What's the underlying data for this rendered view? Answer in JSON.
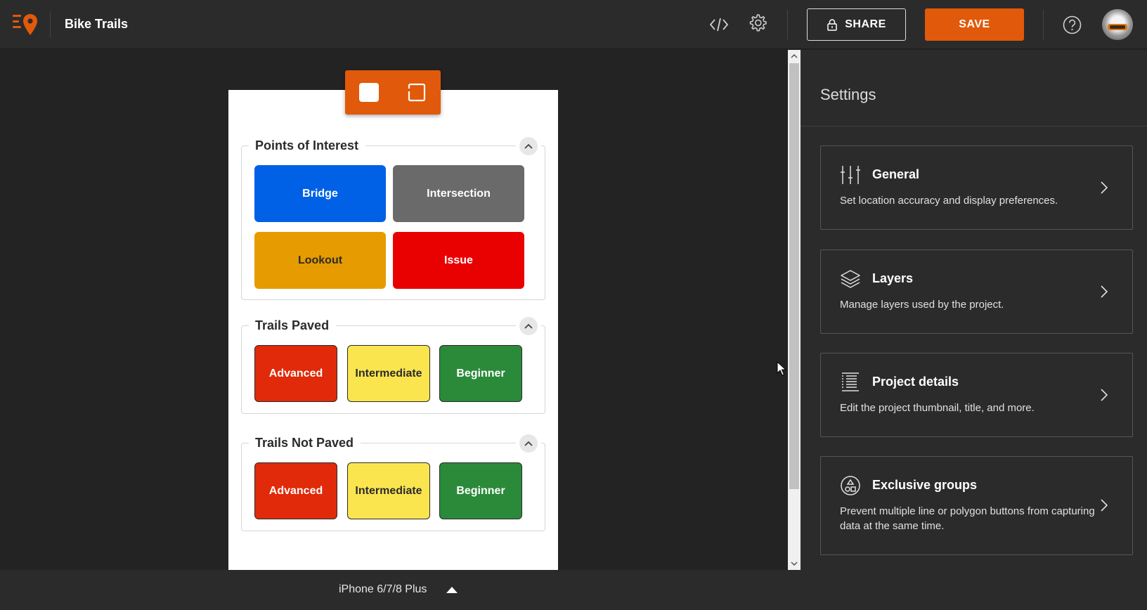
{
  "header": {
    "app_title": "Bike Trails",
    "share_label": "SHARE",
    "save_label": "SAVE"
  },
  "phone": {
    "groups": [
      {
        "title": "Points of Interest",
        "buttons": [
          {
            "label": "Bridge",
            "color": "#0061e6",
            "text_color": "#ffffff"
          },
          {
            "label": "Intersection",
            "color": "#6a6a6a",
            "text_color": "#ffffff"
          },
          {
            "label": "Lookout",
            "color": "#e69b00",
            "text_color": "#2b2b2b"
          },
          {
            "label": "Issue",
            "color": "#e90000",
            "text_color": "#ffffff"
          }
        ]
      },
      {
        "title": "Trails Paved",
        "buttons": [
          {
            "label": "Advanced",
            "color": "#e02a09",
            "text_color": "#ffffff"
          },
          {
            "label": "Intermediate",
            "color": "#fbe54f",
            "text_color": "#2b2b2b"
          },
          {
            "label": "Beginner",
            "color": "#2b8a3a",
            "text_color": "#ffffff"
          }
        ]
      },
      {
        "title": "Trails Not Paved",
        "buttons": [
          {
            "label": "Advanced",
            "color": "#e02a09",
            "text_color": "#ffffff"
          },
          {
            "label": "Intermediate",
            "color": "#fbe54f",
            "text_color": "#2b2b2b"
          },
          {
            "label": "Beginner",
            "color": "#2b8a3a",
            "text_color": "#ffffff"
          }
        ]
      }
    ]
  },
  "bottom_bar": {
    "device_label": "iPhone 6/7/8 Plus"
  },
  "settings": {
    "title": "Settings",
    "cards": [
      {
        "icon": "sliders-icon",
        "title": "General",
        "description": "Set location accuracy and display preferences."
      },
      {
        "icon": "layers-icon",
        "title": "Layers",
        "description": "Manage layers used by the project."
      },
      {
        "icon": "details-icon",
        "title": "Project details",
        "description": "Edit the project thumbnail, title, and more."
      },
      {
        "icon": "shapes-icon",
        "title": "Exclusive groups",
        "description": "Prevent multiple line or polygon buttons from capturing data at the same time."
      }
    ]
  },
  "colors": {
    "accent": "#e1590a",
    "header_bg": "#2b2b2b",
    "canvas_bg": "#232323"
  }
}
